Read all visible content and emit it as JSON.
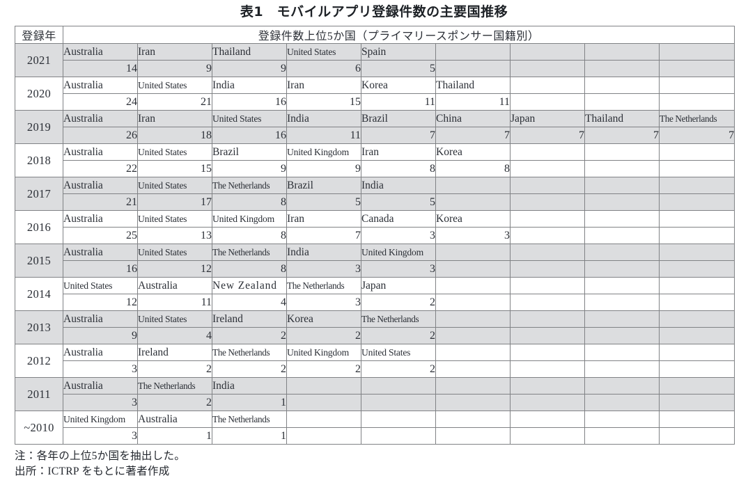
{
  "title": "表1　モバイルアプリ登録件数の主要国推移",
  "header": {
    "year_label": "登録年",
    "span_label": "登録件数上位5か国（プライマリースポンサー国籍別）"
  },
  "notes": {
    "note": "注：各年の上位5か国を抽出した。",
    "source": "出所：ICTRP をもとに著者作成"
  },
  "colors": {
    "shade": "#dcdddf",
    "border": "#808285",
    "text": "#2b2f36",
    "page_bg": "#ffffff"
  },
  "columns": 9,
  "chart_data": {
    "type": "table",
    "title": "表1　モバイルアプリ登録件数の主要国推移",
    "row_header": "登録年",
    "column_header": "登録件数上位5か国（プライマリースポンサー国籍別）",
    "note": "注：各年の上位5か国を抽出した。",
    "source": "出所：ICTRP をもとに著者作成",
    "rows": [
      {
        "year": "2021",
        "shaded": true,
        "countries": [
          "Australia",
          "Iran",
          "Thailand",
          "United States",
          "Spain",
          "",
          "",
          "",
          ""
        ],
        "values": [
          "14",
          "9",
          "9",
          "6",
          "5",
          "",
          "",
          "",
          ""
        ]
      },
      {
        "year": "2020",
        "shaded": false,
        "countries": [
          "Australia",
          "United States",
          "India",
          "Iran",
          "Korea",
          "Thailand",
          "",
          "",
          ""
        ],
        "values": [
          "24",
          "21",
          "16",
          "15",
          "11",
          "11",
          "",
          "",
          ""
        ]
      },
      {
        "year": "2019",
        "shaded": true,
        "countries": [
          "Australia",
          "Iran",
          "United States",
          "India",
          "Brazil",
          "China",
          "Japan",
          "Thailand",
          "The Netherlands"
        ],
        "values": [
          "26",
          "18",
          "16",
          "11",
          "7",
          "7",
          "7",
          "7",
          "7"
        ]
      },
      {
        "year": "2018",
        "shaded": false,
        "countries": [
          "Australia",
          "United States",
          "Brazil",
          "United Kingdom",
          "Iran",
          "Korea",
          "",
          "",
          ""
        ],
        "values": [
          "22",
          "15",
          "9",
          "9",
          "8",
          "8",
          "",
          "",
          ""
        ]
      },
      {
        "year": "2017",
        "shaded": true,
        "countries": [
          "Australia",
          "United States",
          "The Netherlands",
          "Brazil",
          "India",
          "",
          "",
          "",
          ""
        ],
        "values": [
          "21",
          "17",
          "8",
          "5",
          "5",
          "",
          "",
          "",
          ""
        ]
      },
      {
        "year": "2016",
        "shaded": false,
        "countries": [
          "Australia",
          "United States",
          "United Kingdom",
          "Iran",
          "Canada",
          "Korea",
          "",
          "",
          ""
        ],
        "values": [
          "25",
          "13",
          "8",
          "7",
          "3",
          "3",
          "",
          "",
          ""
        ]
      },
      {
        "year": "2015",
        "shaded": true,
        "countries": [
          "Australia",
          "United States",
          "The Netherlands",
          "India",
          "United Kingdom",
          "",
          "",
          "",
          ""
        ],
        "values": [
          "16",
          "12",
          "8",
          "3",
          "3",
          "",
          "",
          "",
          ""
        ]
      },
      {
        "year": "2014",
        "shaded": false,
        "countries": [
          "United States",
          "Australia",
          "New Zealand",
          "The Netherlands",
          "Japan",
          "",
          "",
          "",
          ""
        ],
        "values": [
          "12",
          "11",
          "4",
          "3",
          "2",
          "",
          "",
          "",
          ""
        ]
      },
      {
        "year": "2013",
        "shaded": true,
        "countries": [
          "Australia",
          "United States",
          "Ireland",
          "Korea",
          "The Netherlands",
          "",
          "",
          "",
          ""
        ],
        "values": [
          "9",
          "4",
          "2",
          "2",
          "2",
          "",
          "",
          "",
          ""
        ]
      },
      {
        "year": "2012",
        "shaded": false,
        "countries": [
          "Australia",
          "Ireland",
          "The Netherlands",
          "United Kingdom",
          "United States",
          "",
          "",
          "",
          ""
        ],
        "values": [
          "3",
          "2",
          "2",
          "2",
          "2",
          "",
          "",
          "",
          ""
        ]
      },
      {
        "year": "2011",
        "shaded": true,
        "countries": [
          "Australia",
          "The Netherlands",
          "India",
          "",
          "",
          "",
          "",
          "",
          ""
        ],
        "values": [
          "3",
          "2",
          "1",
          "",
          "",
          "",
          "",
          "",
          ""
        ]
      },
      {
        "year": "~2010",
        "shaded": false,
        "countries": [
          "United Kingdom",
          "Australia",
          "The Netherlands",
          "",
          "",
          "",
          "",
          "",
          ""
        ],
        "values": [
          "3",
          "1",
          "1",
          "",
          "",
          "",
          "",
          "",
          ""
        ]
      }
    ]
  }
}
